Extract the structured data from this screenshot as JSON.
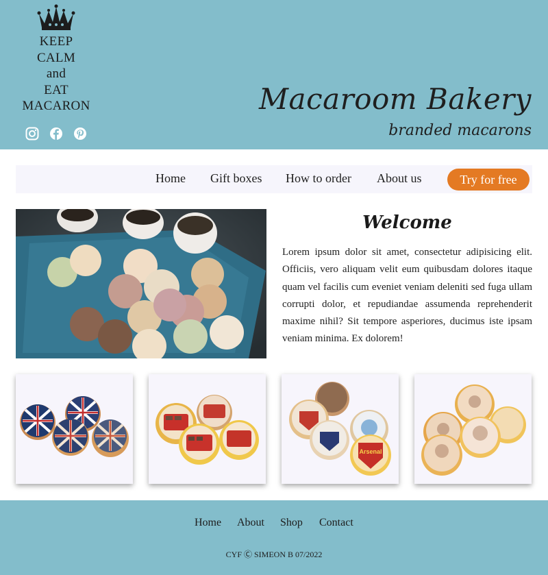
{
  "header": {
    "logo_lines": [
      "KEEP",
      "CALM",
      "and",
      "EAT",
      "MACARON"
    ],
    "brand_title": "Macaroom Bakery",
    "brand_subtitle": "branded macarons",
    "socials": [
      "instagram-icon",
      "facebook-icon",
      "pinterest-icon"
    ],
    "background": "#83bdcb"
  },
  "nav": {
    "items": [
      "Home",
      "Gift boxes",
      "How to order",
      "About us"
    ],
    "cta_label": "Try for free",
    "cta_color": "#e47a23"
  },
  "main": {
    "welcome_title": "Welcome",
    "intro_text": "Lorem ipsum dolor sit amet, consectetur adipisicing elit. Officiis, vero aliquam velit eum quibusdam dolores itaque quam vel facilis cum eveniet veniam deleniti sed fuga ullam corrupti dolor, et repudiandae assumenda reprehenderit maxime nihil? Sit tempore asperiores, ducimus iste ipsam veniam minima. Ex dolorem!",
    "hero_image": "macarons-and-coffee-photo"
  },
  "gallery": {
    "cards": [
      "union-jack-macarons",
      "london-bus-macarons",
      "football-club-macarons",
      "queen-portrait-macarons"
    ],
    "card_texts": {
      "arsenal": "Arsenal"
    }
  },
  "footer": {
    "links": [
      "Home",
      "About",
      "Shop",
      "Contact"
    ],
    "copyright": "CYF Ⓒ SIMEON B 07/2022"
  }
}
